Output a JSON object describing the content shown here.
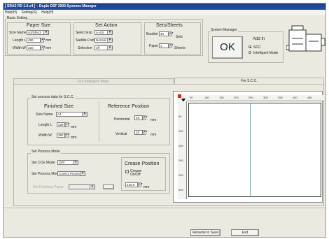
{
  "window_title": "[ SRA3 RD 1.0.x4 ] – Duplo DSF 2000 Systems Manager",
  "menu": [
    "Help(H)",
    "Setting(S)",
    "Help(H)"
  ],
  "basic_setting": {
    "title": "Basic Setting",
    "paper_size": {
      "heading": "Paper Size",
      "size_name_label": "Size Name",
      "size_name_value": "A3/SRA3",
      "length_label": "Length L",
      "length_value": "450",
      "length_unit": "mm",
      "width_label": "Width W",
      "width_value": "320",
      "width_unit": "mm"
    },
    "set_action": {
      "heading": "Set Action",
      "select_exp_label": "Select Exp",
      "select_exp_value": "A-4 B",
      "saddle_fold_label": "Saddle Fold",
      "saddle_fold_value": "Normal",
      "selection_label": "Selection",
      "selection_value": "off"
    },
    "sets_sheets": {
      "heading": "Sets/Sheets",
      "booklet_label": "Booklet",
      "booklet_value": "40",
      "booklet_unit": "Sets",
      "paper_label": "Paper",
      "paper_value": "1",
      "paper_unit": "Sheets"
    }
  },
  "system_manager": {
    "title": "System Manager",
    "ok_label": "OK",
    "add_in_heading": "Add In",
    "option_scc": "SCC",
    "option_intelligent": "Intelligent Mode"
  },
  "tabs": [
    "For Intelligent Mode",
    "For S.C.C."
  ],
  "active_tab_index": 1,
  "scc_panel": {
    "group_title": "Set process data for S.C.C.",
    "finished_size": {
      "heading": "Finished Size",
      "size_name_label": "Size Name",
      "size_name_value": "A4",
      "length_label": "Length L",
      "length_value": "428",
      "length_unit": "mm",
      "width_label": "Width W",
      "width_value": "292",
      "width_unit": "mm"
    },
    "reference_position": {
      "heading": "Reference Position",
      "horizontal_label": "Horizontal",
      "horizontal_value": "10",
      "horizontal_unit": "mm",
      "vertical_label": "Vertical",
      "vertical_value": "10",
      "vertical_unit": "mm"
    }
  },
  "process_mode": {
    "group_title": "Set Process Mode",
    "scc_mode_label": "Set CCE Mode",
    "scc_mode_value": "OFF",
    "process_mode_label": "Set Process Mode",
    "process_mode_value": "Cover1 Process",
    "finishing_paper_label": "Set Finishing Paper",
    "crease_position": {
      "heading": "Crease Position",
      "checkbox_label": "Crease On/Off",
      "checkbox_checked": true,
      "value": "210.0",
      "unit": "mm"
    }
  },
  "ruler": {
    "h_ticks": [
      "50",
      "100",
      "150",
      "200",
      "250",
      "300",
      "350",
      "400",
      "450"
    ],
    "v_ticks": [
      "50",
      "100",
      "150",
      "200",
      "250",
      "300"
    ]
  },
  "footer": {
    "rename_save": "Rename to Save",
    "exit": "Exit"
  }
}
